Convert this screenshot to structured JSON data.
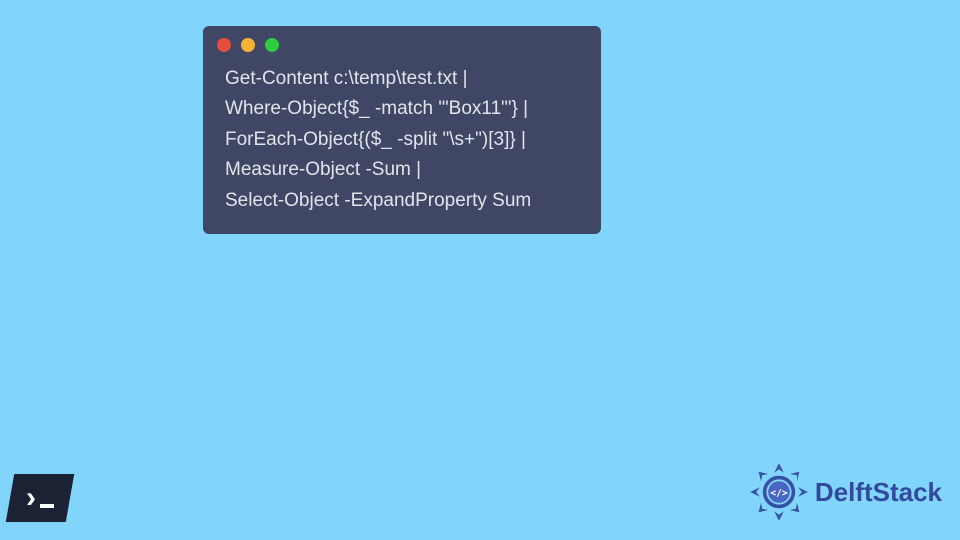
{
  "window": {
    "dots": {
      "red": "#e74c3c",
      "yellow": "#f5b333",
      "green": "#2ecc40"
    }
  },
  "code": {
    "line1": "Get-Content c:\\temp\\test.txt |",
    "line2": "Where-Object{$_ -match '\"Box11\"'} |",
    "line3": "ForEach-Object{($_ -split \"\\s+\")[3]} |",
    "line4": "Measure-Object -Sum |",
    "line5": "Select-Object -ExpandProperty Sum"
  },
  "brand": {
    "text": "DelftStack"
  },
  "icons": {
    "powershell": "powershell-icon",
    "brand_logo": "delftstack-logo"
  }
}
